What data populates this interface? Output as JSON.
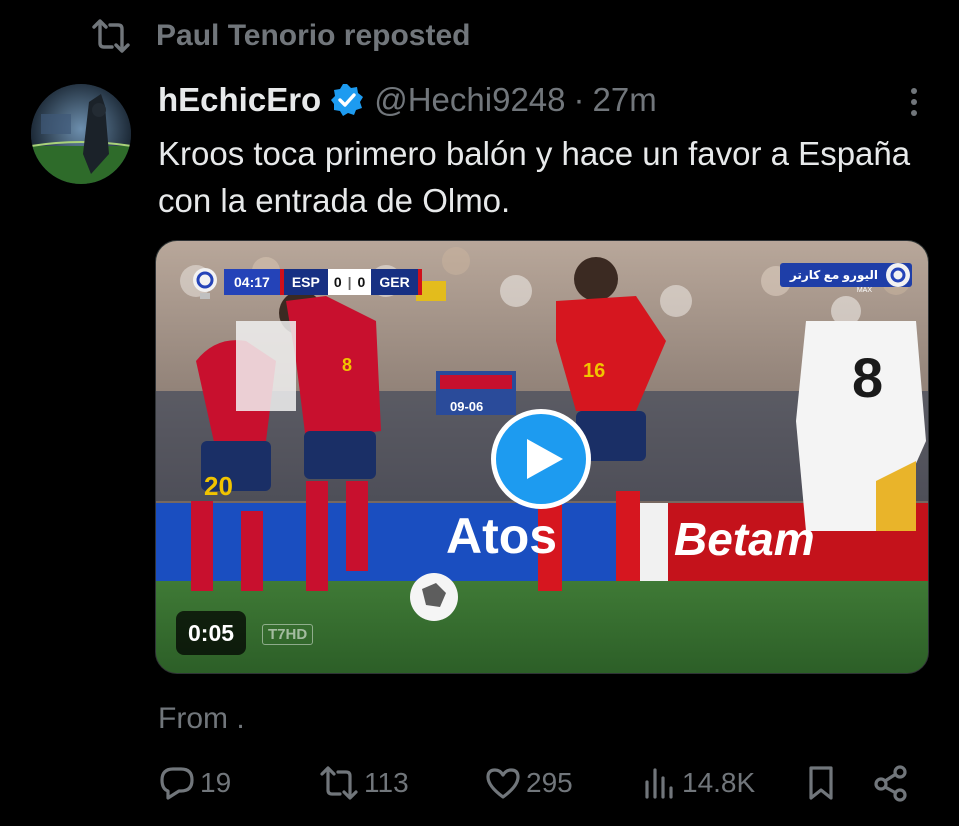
{
  "repost": {
    "text": "Paul Tenorio reposted",
    "icon": "repost-icon"
  },
  "author": {
    "display_name": "hEchicEro",
    "verified_icon": "verified-badge-icon",
    "handle": "@Hechi9248",
    "separator": "·",
    "time": "27m"
  },
  "tweet": {
    "text": "Kroos toca primero balón y hace un favor a España con la entrada de Olmo."
  },
  "video": {
    "scorebug": {
      "clock": "04:17",
      "home": "ESP",
      "home_score": "0",
      "separator": "|",
      "away_score": "0",
      "away": "GER"
    },
    "channel": {
      "name": "اليورو مع كارتر",
      "sub": "MAX"
    },
    "duration": "0:05",
    "watermark": "T7HD",
    "ad_boards": [
      "Atos",
      "Betam"
    ],
    "jersey_numbers": [
      "20",
      "8",
      "16",
      "8"
    ],
    "stand_sign": {
      "line1": "09-06"
    },
    "play_icon": "play-icon"
  },
  "from_text": "From .",
  "actions": {
    "replies": "19",
    "reposts": "113",
    "likes": "295",
    "views": "14.8K"
  },
  "colors": {
    "background": "#000000",
    "text": "#e7e9ea",
    "muted": "#71767b",
    "accent": "#1d9bf0"
  }
}
